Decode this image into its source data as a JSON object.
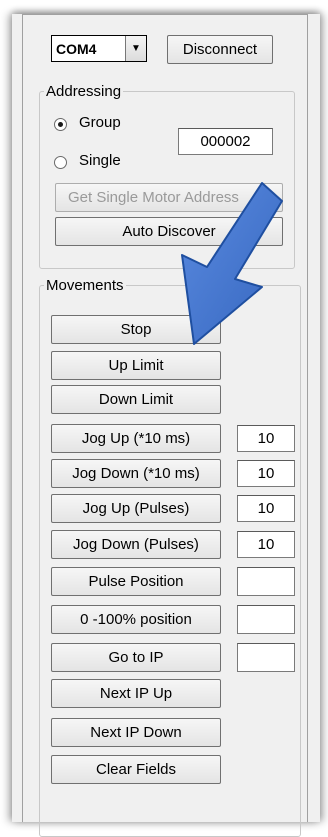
{
  "port": {
    "selected": "COM4",
    "arrow_glyph": "▼"
  },
  "toolbar": {
    "disconnect_label": "Disconnect"
  },
  "addressing": {
    "legend": "Addressing",
    "group_label": "Group",
    "single_label": "Single",
    "group_value": "000002",
    "selected": "group",
    "get_single_label": "Get Single Motor Address",
    "auto_discover_label": "Auto Discover"
  },
  "movements": {
    "legend": "Movements",
    "stop_label": "Stop",
    "up_limit_label": "Up Limit",
    "down_limit_label": "Down Limit",
    "jog_up_ms_label": "Jog Up (*10 ms)",
    "jog_up_ms_value": "10",
    "jog_down_ms_label": "Jog Down (*10 ms)",
    "jog_down_ms_value": "10",
    "jog_up_pulses_label": "Jog Up (Pulses)",
    "jog_up_pulses_value": "10",
    "jog_down_pulses_label": "Jog Down (Pulses)",
    "jog_down_pulses_value": "10",
    "pulse_position_label": "Pulse Position",
    "pulse_position_value": "",
    "percent_position_label": "0 -100% position",
    "percent_position_value": "",
    "go_to_ip_label": "Go to IP",
    "go_to_ip_value": "",
    "next_ip_up_label": "Next IP Up",
    "next_ip_down_label": "Next IP Down",
    "clear_fields_label": "Clear Fields"
  },
  "colors": {
    "annotation_arrow": "#3c6fc4",
    "annotation_arrow_border": "#1f4fa0"
  }
}
